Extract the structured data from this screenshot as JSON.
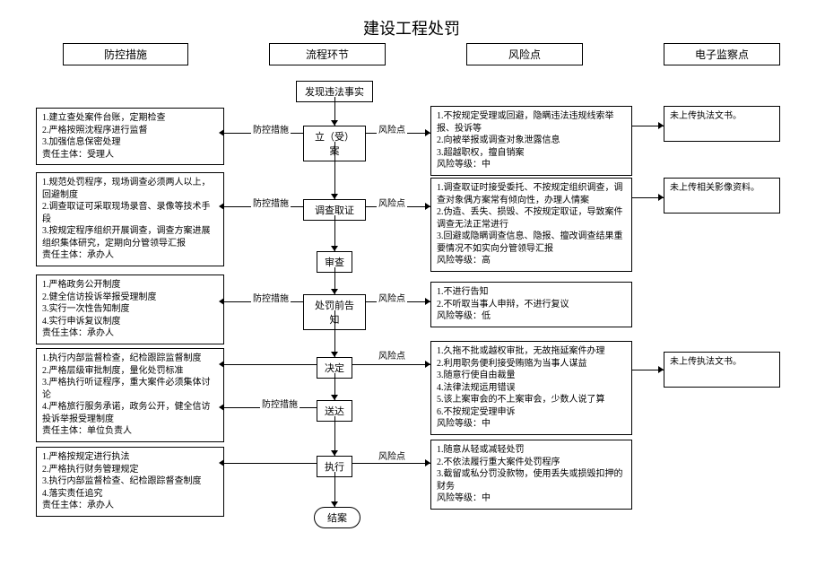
{
  "title": "建设工程处罚",
  "headers": {
    "col1": "防控措施",
    "col2": "流程环节",
    "col3": "风险点",
    "col4": "电子监察点"
  },
  "flow": {
    "start": "发现违法事实",
    "step1": "立（受）案",
    "step2": "调查取证",
    "step3": "审查",
    "step4": "处罚前告知",
    "step5": "决定",
    "step6": "送达",
    "step7": "执行",
    "end": "结案"
  },
  "labels": {
    "fkcs": "防控措施",
    "fxd": "风险点"
  },
  "prevent": {
    "p1": "1.建立查处案件台账，定期检查\n2.严格按照沈程序进行监督\n3.加强信息保密处理\n责任主体：受理人",
    "p2": "1.规范处罚程序，现场调查必须两人以上，回避制度\n2.调查取证可采取现场录音、录像等技术手段\n3.按规定程序组织开展调查，调查方案进展组织集体研究，定期向分管领导汇报\n责任主体：承办人",
    "p3": "1.严格政务公开制度\n2.健全信访投诉举报受理制度\n3.实行一次性告知制度\n4.实行申诉复议制度\n责任主体：承办人",
    "p4": "1.执行内部监督检查，纪检跟踪监督制度\n2.严格层级审批制度，量化处罚标准\n3.严格执行听证程序，重大案件必须集体讨论\n4.严格旅行服务承诺，政务公开，健全信访投诉举报受理制度\n责任主体：单位负责人",
    "p5": "1.严格按规定进行执法\n2.严格执行财务管理规定\n3.执行内部监督检查、纪检跟踪督查制度\n4.落实责任追究\n责任主体：承办人"
  },
  "risk": {
    "r1": "1.不按规定受理或回避，隐瞒违法违规线索举报、投诉等\n2.向被举报或调查对象泄露信息\n3.超越职权，擅自销案\n风险等级：中",
    "r2": "1.调查取证时接受委托、不按规定组织调查，调查对象偶方案常有倾向性，办理人情案\n2.伪造、丢失、损毁、不按规定取证，导致案件调查无法正常进行\n3.回避或隐瞒调查信息、隐报、擅改调查结果重要情况不如实向分管领导汇报\n风险等级：高",
    "r3": "1.不进行告知\n2.不听取当事人申辩，不进行复议\n风险等级：低",
    "r4": "1.久拖不批或越权审批，无故拖延案件办理\n2.利用职务便利接受贿赂为当事人谋益\n3.随意行使自由裁量\n4.法律法规运用错误\n5.该上案审会的不上案审会，少数人说了算\n6.不按规定受理申诉\n风险等级：中",
    "r5": "1.随意从轻或减轻处罚\n2.不依法履行重大案件处罚程序\n3.截留或私分罚没款物，使用丢失或损毁扣押的财务\n风险等级：中"
  },
  "monitor": {
    "m1": "未上传执法文书。",
    "m2": "未上传相关影像资料。",
    "m3": "未上传执法文书。"
  }
}
